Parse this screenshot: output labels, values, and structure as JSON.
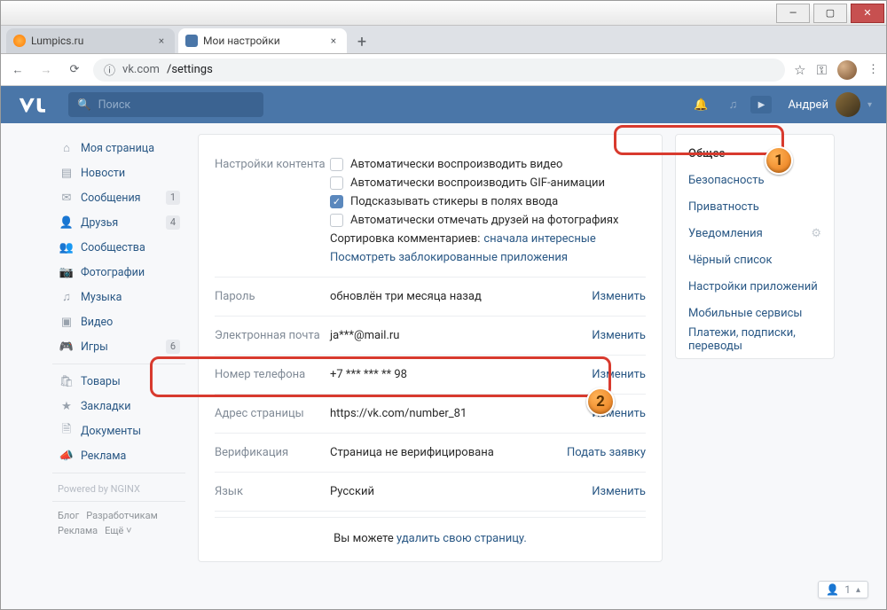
{
  "chrome": {
    "tabs": [
      {
        "title": "Lumpics.ru",
        "active": false
      },
      {
        "title": "Мои настройки",
        "active": true
      }
    ],
    "url_host": "vk.com",
    "url_path": "/settings"
  },
  "vk_header": {
    "search_placeholder": "Поиск",
    "username": "Андрей"
  },
  "left_nav": {
    "items": [
      {
        "icon": "⌂",
        "label": "Моя страница",
        "badge": ""
      },
      {
        "icon": "≣",
        "label": "Новости",
        "badge": ""
      },
      {
        "icon": "✉",
        "label": "Сообщения",
        "badge": "1"
      },
      {
        "icon": "👤",
        "label": "Друзья",
        "badge": "4"
      },
      {
        "icon": "👥",
        "label": "Сообщества",
        "badge": ""
      },
      {
        "icon": "📷",
        "label": "Фотографии",
        "badge": ""
      },
      {
        "icon": "♫",
        "label": "Музыка",
        "badge": ""
      },
      {
        "icon": "▣",
        "label": "Видео",
        "badge": ""
      },
      {
        "icon": "🎮",
        "label": "Игры",
        "badge": "6"
      }
    ],
    "items2": [
      {
        "icon": "🛍",
        "label": "Товары"
      },
      {
        "icon": "★",
        "label": "Закладки"
      },
      {
        "icon": "🗎",
        "label": "Документы"
      },
      {
        "icon": "📣",
        "label": "Реклама"
      }
    ],
    "powered": "Powered by NGINX",
    "footer": [
      "Блог",
      "Разработчикам",
      "Реклама",
      "Ещё ˅"
    ]
  },
  "settings": {
    "content_label": "Настройки контента",
    "content_opts": {
      "autoplay_video": "Автоматически воспроизводить видео",
      "autoplay_gif": "Автоматически воспроизводить GIF-анимации",
      "sticker_hint": "Подсказывать стикеры в полях ввода",
      "autotag": "Автоматически отмечать друзей на фотографиях",
      "sort_label": "Сортировка комментариев:",
      "sort_value": "сначала интересные",
      "blocked_apps": "Посмотреть заблокированные приложения"
    },
    "rows": {
      "password": {
        "label": "Пароль",
        "value": "обновлён три месяца назад",
        "action": "Изменить"
      },
      "email": {
        "label": "Электронная почта",
        "value": "ja***@mail.ru",
        "action": "Изменить"
      },
      "phone": {
        "label": "Номер телефона",
        "value": "+7 *** *** ** 98",
        "action": "Изменить"
      },
      "address": {
        "label": "Адрес страницы",
        "value": "https://vk.com/number_81",
        "action": "Изменить"
      },
      "verify": {
        "label": "Верификация",
        "value": "Страница не верифицирована",
        "action": "Подать заявку"
      },
      "lang": {
        "label": "Язык",
        "value": "Русский",
        "action": "Изменить"
      }
    },
    "footer_text": "Вы можете ",
    "footer_link": "удалить свою страницу."
  },
  "right_nav": {
    "items": [
      "Общее",
      "Безопасность",
      "Приватность",
      "Уведомления",
      "Чёрный список",
      "Настройки приложений",
      "Мобильные сервисы",
      "Платежи, подписки, переводы"
    ]
  },
  "mini_dock": {
    "count": "1"
  }
}
